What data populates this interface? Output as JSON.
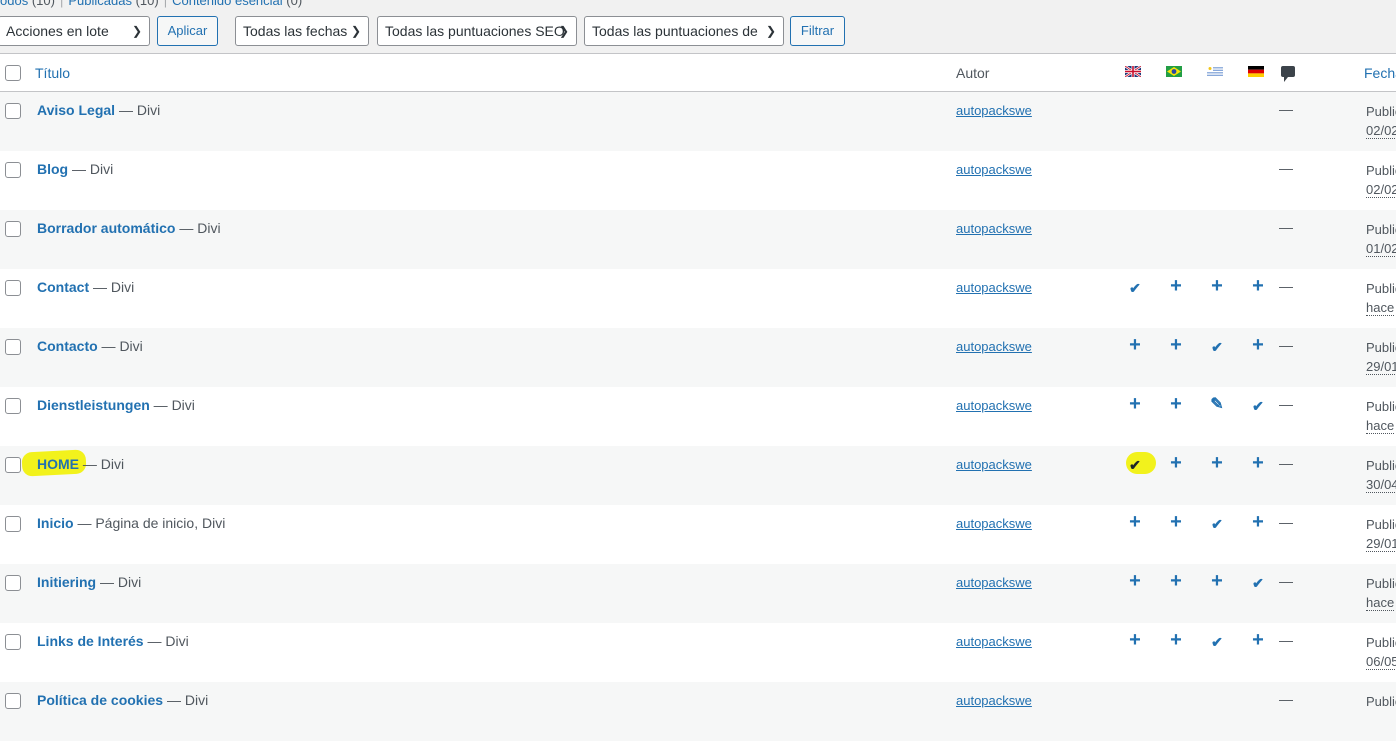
{
  "subsubsub": {
    "all": "odos",
    "all_count": "(10)",
    "published": "Publicadas",
    "published_count": "(10)",
    "cornerstone": "Contenido esencial",
    "cornerstone_count": "(0)"
  },
  "toolbar": {
    "bulk_actions": "Acciones en lote",
    "apply": "Aplicar",
    "dates": "Todas las fechas",
    "seo_scores": "Todas las puntuaciones SEO",
    "readability_scores": "Todas las puntuaciones de",
    "filter": "Filtrar"
  },
  "columns": {
    "title": "Título",
    "author": "Autor",
    "flags": [
      "en-flag-icon",
      "br-flag-icon",
      "uy-flag-icon",
      "de-flag-icon"
    ],
    "comments_icon": "comment-icon",
    "date": "Fecha"
  },
  "colors": {
    "link": "#2271b1",
    "highlight": "#f2f21c"
  },
  "rows": [
    {
      "title": "Aviso Legal",
      "state": " — Divi",
      "author": "autopackswe",
      "langs": [
        "",
        "",
        "",
        ""
      ],
      "comments": "—",
      "date1": "Publicada",
      "date2": "02/02"
    },
    {
      "title": "Blog",
      "state": " — Divi",
      "author": "autopackswe",
      "langs": [
        "",
        "",
        "",
        ""
      ],
      "comments": "—",
      "date1": "Publicada",
      "date2": "02/02"
    },
    {
      "title": "Borrador automático",
      "state": " — Divi",
      "author": "autopackswe",
      "langs": [
        "",
        "",
        "",
        ""
      ],
      "comments": "—",
      "date1": "Publicada",
      "date2": "01/02"
    },
    {
      "title": "Contact",
      "state": " — Divi",
      "author": "autopackswe",
      "langs": [
        "check",
        "plus",
        "plus",
        "plus"
      ],
      "comments": "—",
      "date1": "Publicada",
      "date2": "hace"
    },
    {
      "title": "Contacto",
      "state": " — Divi",
      "author": "autopackswe",
      "langs": [
        "plus",
        "plus",
        "check",
        "plus"
      ],
      "comments": "—",
      "date1": "Publicada",
      "date2": "29/01"
    },
    {
      "title": "Dienstleistungen",
      "state": " — Divi",
      "author": "autopackswe",
      "langs": [
        "plus",
        "plus",
        "pencil",
        "check"
      ],
      "comments": "—",
      "date1": "Publicada",
      "date2": "hace"
    },
    {
      "title": "HOME",
      "state": " — Divi",
      "author": "autopackswe",
      "langs": [
        "check",
        "plus",
        "plus",
        "plus"
      ],
      "comments": "—",
      "date1": "Publicada",
      "date2": "30/04",
      "highlight": true
    },
    {
      "title": "Inicio",
      "state": " — Página de inicio, Divi",
      "author": "autopackswe",
      "langs": [
        "plus",
        "plus",
        "check",
        "plus"
      ],
      "comments": "—",
      "date1": "Publicada",
      "date2": "29/01"
    },
    {
      "title": "Initiering",
      "state": " — Divi",
      "author": "autopackswe",
      "langs": [
        "plus",
        "plus",
        "plus",
        "check"
      ],
      "comments": "—",
      "date1": "Publicada",
      "date2": "hace"
    },
    {
      "title": "Links de Interés",
      "state": " — Divi",
      "author": "autopackswe",
      "langs": [
        "plus",
        "plus",
        "check",
        "plus"
      ],
      "comments": "—",
      "date1": "Publicada",
      "date2": "06/05"
    },
    {
      "title": "Política de cookies",
      "state": " — Divi",
      "author": "autopackswe",
      "langs": [
        "",
        "",
        "",
        ""
      ],
      "comments": "—",
      "date1": "Publicada",
      "date2": ""
    }
  ]
}
